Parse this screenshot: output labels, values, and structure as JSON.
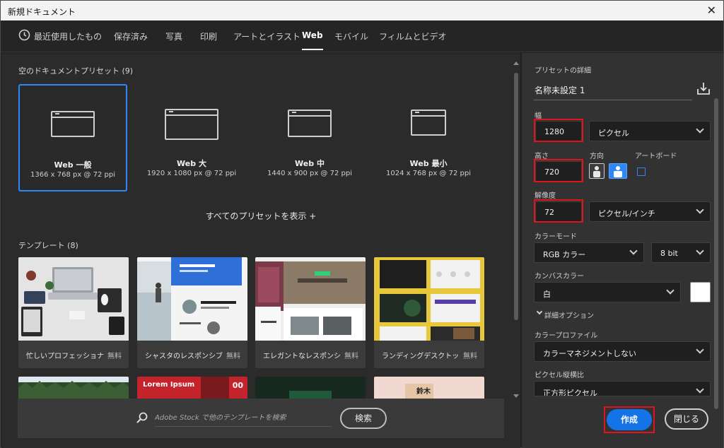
{
  "window": {
    "title": "新規ドキュメント"
  },
  "tabs": [
    {
      "label": "最近使用したもの"
    },
    {
      "label": "保存済み"
    },
    {
      "label": "写真"
    },
    {
      "label": "印刷"
    },
    {
      "label": "アートとイラスト"
    },
    {
      "label": "Web"
    },
    {
      "label": "モバイル"
    },
    {
      "label": "フィルムとビデオ"
    }
  ],
  "active_tab": "Web",
  "presets_section": {
    "title": "空のドキュメントプリセット (9)"
  },
  "presets": [
    {
      "name": "Web 一般",
      "size": "1366 x 768 px @ 72 ppi"
    },
    {
      "name": "Web 大",
      "size": "1920 x 1080 px @ 72 ppi"
    },
    {
      "name": "Web 中",
      "size": "1440 x 900 px @ 72 ppi"
    },
    {
      "name": "Web 最小",
      "size": "1024 x 768 px @ 72 ppi"
    }
  ],
  "show_all": "すべてのプリセットを表示 +",
  "templates_section": {
    "title": "テンプレート (8)"
  },
  "templates": [
    {
      "name": "忙しいプロフェッショナ...",
      "price": "無料"
    },
    {
      "name": "シャスタのレスポンシブ...",
      "price": "無料"
    },
    {
      "name": "エレガントなレスポンシ...",
      "price": "無料"
    },
    {
      "name": "ランディングデスクトッ...",
      "price": "無料"
    }
  ],
  "template_row2": {
    "lorem_title": "Lorem Ipsum",
    "lorem_num": "00",
    "jp_label": "鈴木"
  },
  "search": {
    "placeholder": "Adobe Stock で他のテンプレートを検索",
    "button": "検索"
  },
  "details": {
    "title": "プリセットの詳細",
    "doc_name": "名称未設定 1",
    "width_label": "幅",
    "width_value": "1280",
    "width_unit": "ピクセル",
    "height_label": "高さ",
    "height_value": "720",
    "orientation_label": "方向",
    "artboard_label": "アートボード",
    "resolution_label": "解像度",
    "resolution_value": "72",
    "resolution_unit": "ピクセル/インチ",
    "color_mode_label": "カラーモード",
    "color_mode": "RGB カラー",
    "bit_depth": "8 bit",
    "canvas_color_label": "カンバスカラー",
    "canvas_color": "白",
    "advanced_label": "詳細オプション",
    "color_profile_label": "カラープロファイル",
    "color_profile": "カラーマネジメントしない",
    "pixel_aspect_label": "ピクセル縦横比",
    "pixel_aspect": "正方形ピクセル"
  },
  "actions": {
    "create": "作成",
    "close": "閉じる"
  },
  "colors": {
    "accent": "#1473e6",
    "selection": "#2f86f6",
    "highlight_box": "#e0141c"
  }
}
